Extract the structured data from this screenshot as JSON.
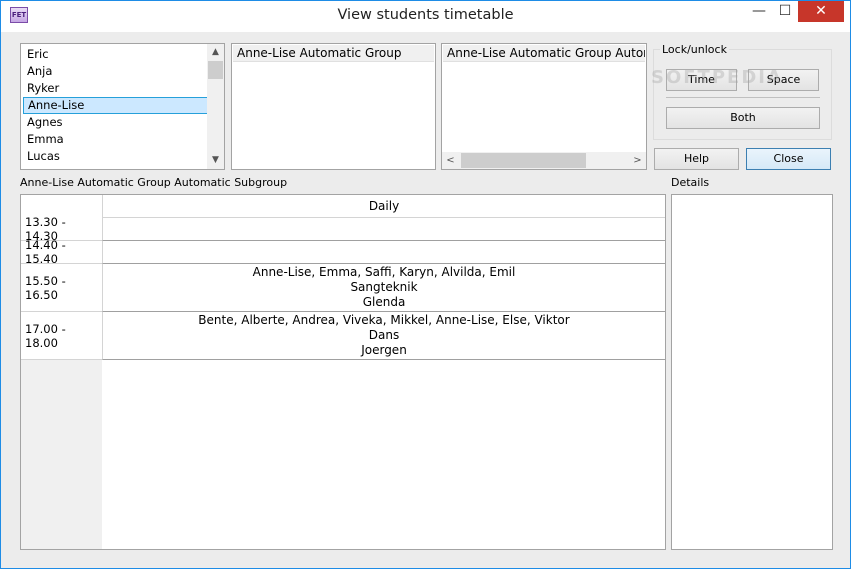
{
  "window": {
    "title": "View students timetable",
    "app_icon_text": "FET",
    "minimize_glyph": "—",
    "maximize_glyph": "☐",
    "close_glyph": "✕"
  },
  "students_list": {
    "items": [
      "Eric",
      "Anja",
      "Ryker",
      "Anne-Lise",
      "Agnes",
      "Emma",
      "Lucas"
    ],
    "selected": "Anne-Lise"
  },
  "groups_list": {
    "items": [
      "Anne-Lise Automatic Group"
    ]
  },
  "subgroups_list": {
    "items": [
      "Anne-Lise Automatic Group Automatic Subgroup"
    ]
  },
  "lock_unlock": {
    "label": "Lock/unlock",
    "time_button": "Time",
    "space_button": "Space",
    "both_button": "Both"
  },
  "actions": {
    "help_button": "Help",
    "close_button": "Close"
  },
  "timetable": {
    "caption": "Anne-Lise Automatic Group Automatic Subgroup",
    "column_header": "Daily",
    "rows": [
      {
        "time": "13.30 - 14.30",
        "lines": []
      },
      {
        "time": "14.40 - 15.40",
        "lines": []
      },
      {
        "time": "15.50 - 16.50",
        "lines": [
          "Anne-Lise, Emma, Saffi, Karyn, Alvilda, Emil",
          "Sangteknik",
          "Glenda"
        ]
      },
      {
        "time": "17.00 - 18.00",
        "lines": [
          "Bente, Alberte, Andrea, Viveka, Mikkel, Anne-Lise, Else, Viktor",
          "Dans",
          "Joergen"
        ]
      }
    ]
  },
  "details": {
    "label": "Details"
  },
  "watermark": "SOFTPEDIA",
  "scroll_glyphs": {
    "up": "▲",
    "down": "▼",
    "left": "<",
    "right": ">"
  },
  "colors": {
    "selection_fill": "#cce8ff",
    "selection_border": "#26a0da",
    "close_button_red": "#c7362a",
    "window_border": "#1e8ce6"
  }
}
